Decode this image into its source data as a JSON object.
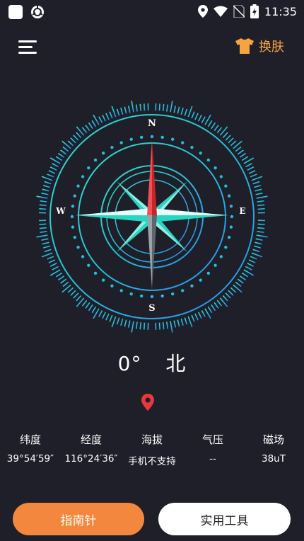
{
  "status_bar": {
    "time": "11:35",
    "icons": [
      "app-square-icon",
      "sync-icon",
      "location-icon",
      "wifi-icon",
      "no-sim-icon",
      "battery-charging-icon"
    ]
  },
  "header": {
    "menu_icon": "hamburger-menu-icon",
    "skin_icon": "tshirt-icon",
    "skin_label": "换肤"
  },
  "compass": {
    "n": "N",
    "e": "E",
    "s": "S",
    "w": "W"
  },
  "heading": {
    "degrees": "0°",
    "direction": "北"
  },
  "info": {
    "labels": [
      "纬度",
      "经度",
      "海拔",
      "气压",
      "磁场"
    ],
    "values": [
      "39°54′59″",
      "116°24′36″",
      "手机不支持",
      "--",
      "38uT"
    ]
  },
  "buttons": {
    "compass": "指南针",
    "tools": "实用工具"
  },
  "colors": {
    "background": "#1f1f2a",
    "accent_orange": "#f3873d",
    "skin_label": "#f6a443",
    "needle_red": "#e8383d",
    "teal": "#2de0c8",
    "blue": "#2a8cf0",
    "pin_red": "#e8383d"
  }
}
